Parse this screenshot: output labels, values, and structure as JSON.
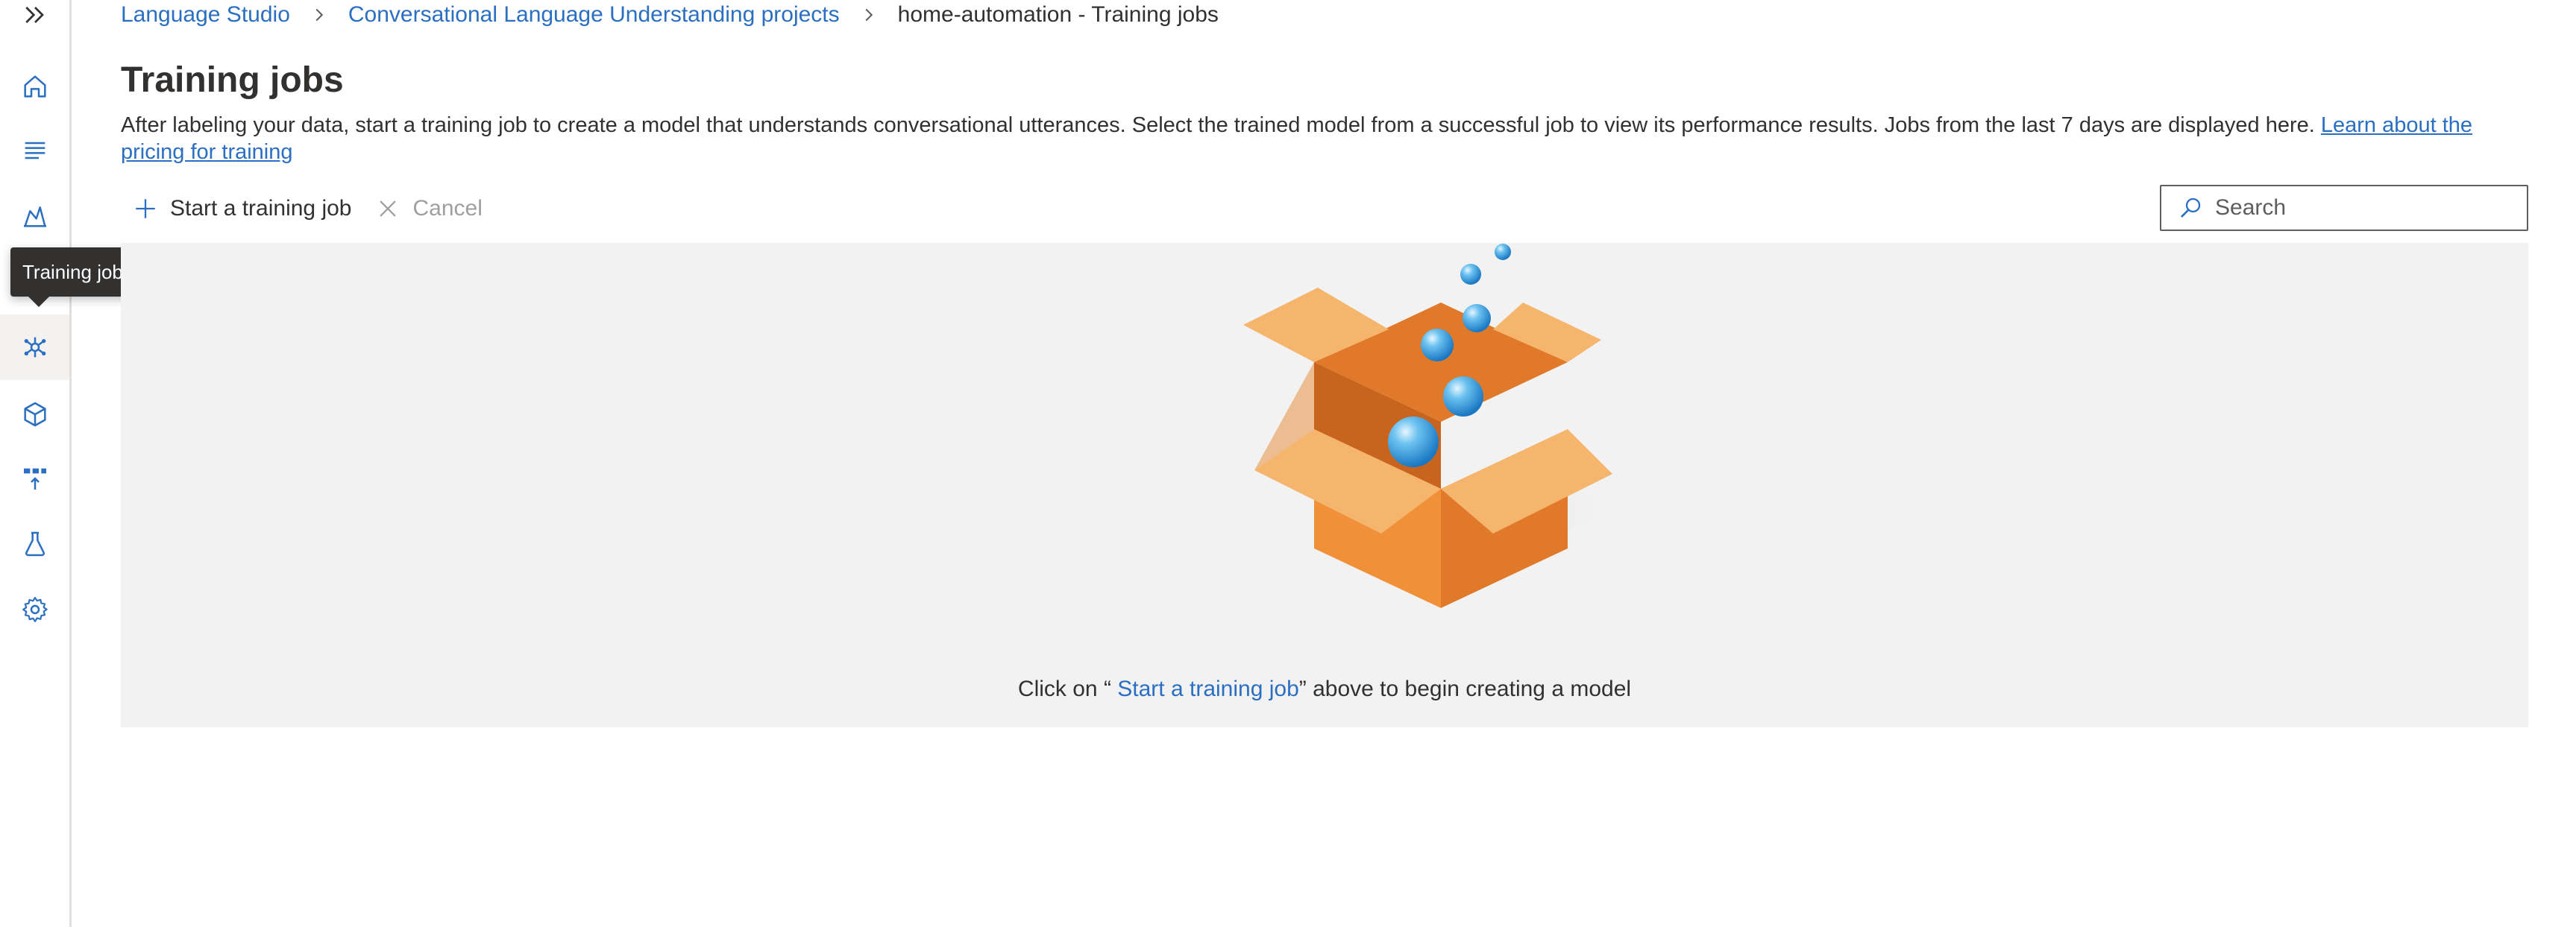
{
  "sidebar": {
    "expand_icon": "double-chevron-right-icon",
    "items": [
      {
        "icon": "home-icon"
      },
      {
        "icon": "text-list-icon"
      },
      {
        "icon": "data-labeling-icon"
      },
      {
        "icon": "training-jobs-icon",
        "active": true
      },
      {
        "icon": "model-performance-icon"
      },
      {
        "icon": "deploy-icon"
      },
      {
        "icon": "test-flask-icon"
      },
      {
        "icon": "gear-icon"
      }
    ],
    "tooltip": "Training jobs"
  },
  "breadcrumb": {
    "items": [
      "Language Studio",
      "Conversational Language Understanding projects"
    ],
    "current": "home-automation - Training jobs"
  },
  "page": {
    "title": "Training jobs",
    "description": "After labeling your data, start a training job to create a model that understands conversational utterances. Select the trained model from a successful job to view its performance results. Jobs from the last 7 days are displayed here. ",
    "learn_more_link": "Learn about the pricing for training"
  },
  "toolbar": {
    "start_label": "Start a training job",
    "cancel_label": "Cancel"
  },
  "search": {
    "placeholder": "Search"
  },
  "empty_state": {
    "prefix": "Click on “ ",
    "link": "Start a training job",
    "suffix": "” above to begin creating a model"
  },
  "colors": {
    "accent": "#2a6fc2",
    "panel_bg": "#f2f2f2",
    "box_orange": "#f0913a",
    "bubble_blue": "#3aa0e0"
  }
}
